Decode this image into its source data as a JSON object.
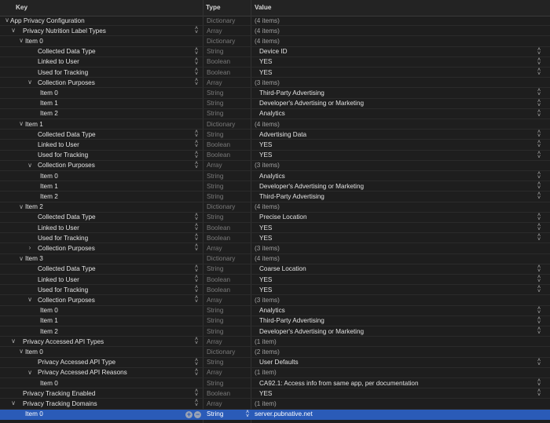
{
  "columns": {
    "key": "Key",
    "type": "Type",
    "value": "Value"
  },
  "rows": [
    {
      "key": "App Privacy Configuration",
      "type": "Dictionary",
      "value": "(4 items)",
      "depth": 0,
      "disc": "open"
    },
    {
      "key": "Privacy Nutrition Label Types",
      "type": "Array",
      "value": "(4 items)",
      "depth": 1,
      "disc": "open",
      "kstep": true
    },
    {
      "key": "Item 0",
      "type": "Dictionary",
      "value": "(4 items)",
      "depth": 2,
      "disc": "open"
    },
    {
      "key": "Collected Data Type",
      "type": "String",
      "value": "Device ID",
      "depth": 3,
      "kstep": true,
      "vstep": true
    },
    {
      "key": "Linked to User",
      "type": "Boolean",
      "value": "YES",
      "depth": 3,
      "kstep": true,
      "vstep": true
    },
    {
      "key": "Used for Tracking",
      "type": "Boolean",
      "value": "YES",
      "depth": 3,
      "kstep": true,
      "vstep": true
    },
    {
      "key": "Collection Purposes",
      "type": "Array",
      "value": "(3 items)",
      "depth": 3,
      "disc": "open",
      "kstep": true
    },
    {
      "key": "Item 0",
      "type": "String",
      "value": "Third-Party Advertising",
      "depth": 4,
      "vstep": true
    },
    {
      "key": "Item 1",
      "type": "String",
      "value": "Developer's Advertising or Marketing",
      "depth": 4,
      "vstep": true
    },
    {
      "key": "Item 2",
      "type": "String",
      "value": "Analytics",
      "depth": 4,
      "vstep": true
    },
    {
      "key": "Item 1",
      "type": "Dictionary",
      "value": "(4 items)",
      "depth": 2,
      "disc": "open"
    },
    {
      "key": "Collected Data Type",
      "type": "String",
      "value": "Advertising Data",
      "depth": 3,
      "kstep": true,
      "vstep": true
    },
    {
      "key": "Linked to User",
      "type": "Boolean",
      "value": "YES",
      "depth": 3,
      "kstep": true,
      "vstep": true
    },
    {
      "key": "Used for Tracking",
      "type": "Boolean",
      "value": "YES",
      "depth": 3,
      "kstep": true,
      "vstep": true
    },
    {
      "key": "Collection Purposes",
      "type": "Array",
      "value": "(3 items)",
      "depth": 3,
      "disc": "open",
      "kstep": true
    },
    {
      "key": "Item 0",
      "type": "String",
      "value": "Analytics",
      "depth": 4,
      "vstep": true
    },
    {
      "key": "Item 1",
      "type": "String",
      "value": "Developer's Advertising or Marketing",
      "depth": 4,
      "vstep": true
    },
    {
      "key": "Item 2",
      "type": "String",
      "value": "Third-Party Advertising",
      "depth": 4,
      "vstep": true
    },
    {
      "key": "Item 2",
      "type": "Dictionary",
      "value": "(4 items)",
      "depth": 2,
      "disc": "open"
    },
    {
      "key": "Collected Data Type",
      "type": "String",
      "value": "Precise Location",
      "depth": 3,
      "kstep": true,
      "vstep": true
    },
    {
      "key": "Linked to User",
      "type": "Boolean",
      "value": "YES",
      "depth": 3,
      "kstep": true,
      "vstep": true
    },
    {
      "key": "Used for Tracking",
      "type": "Boolean",
      "value": "YES",
      "depth": 3,
      "kstep": true,
      "vstep": true
    },
    {
      "key": "Collection Purposes",
      "type": "Array",
      "value": "(3 items)",
      "depth": 3,
      "disc": "closed",
      "kstep": true
    },
    {
      "key": "Item 3",
      "type": "Dictionary",
      "value": "(4 items)",
      "depth": 2,
      "disc": "open"
    },
    {
      "key": "Collected Data Type",
      "type": "String",
      "value": "Coarse Location",
      "depth": 3,
      "kstep": true,
      "vstep": true
    },
    {
      "key": "Linked to User",
      "type": "Boolean",
      "value": "YES",
      "depth": 3,
      "kstep": true,
      "vstep": true
    },
    {
      "key": "Used for Tracking",
      "type": "Boolean",
      "value": "YES",
      "depth": 3,
      "kstep": true,
      "vstep": true
    },
    {
      "key": "Collection Purposes",
      "type": "Array",
      "value": "(3 items)",
      "depth": 3,
      "disc": "open",
      "kstep": true
    },
    {
      "key": "Item 0",
      "type": "String",
      "value": "Analytics",
      "depth": 4,
      "vstep": true
    },
    {
      "key": "Item 1",
      "type": "String",
      "value": "Third-Party Advertising",
      "depth": 4,
      "vstep": true
    },
    {
      "key": "Item 2",
      "type": "String",
      "value": "Developer's Advertising or Marketing",
      "depth": 4,
      "vstep": true
    },
    {
      "key": "Privacy Accessed API Types",
      "type": "Array",
      "value": "(1 item)",
      "depth": 1,
      "disc": "open",
      "kstep": true
    },
    {
      "key": "Item 0",
      "type": "Dictionary",
      "value": "(2 items)",
      "depth": 2,
      "disc": "open"
    },
    {
      "key": "Privacy Accessed API Type",
      "type": "String",
      "value": "User Defaults",
      "depth": 3,
      "kstep": true,
      "vstep": true
    },
    {
      "key": "Privacy Accessed API Reasons",
      "type": "Array",
      "value": "(1 item)",
      "depth": 3,
      "disc": "open",
      "kstep": true
    },
    {
      "key": "Item 0",
      "type": "String",
      "value": "CA92.1: Access info from same app, per documentation",
      "depth": 4,
      "vstep": true
    },
    {
      "key": "Privacy Tracking Enabled",
      "type": "Boolean",
      "value": "YES",
      "depth": 1,
      "kstep": true,
      "vstep": true
    },
    {
      "key": "Privacy Tracking Domains",
      "type": "Array",
      "value": "(1 item)",
      "depth": 1,
      "disc": "open",
      "kstep": true
    },
    {
      "key": "Item 0",
      "type": "String",
      "value": "server.pubnative.net",
      "depth": 2,
      "selected": true
    }
  ]
}
